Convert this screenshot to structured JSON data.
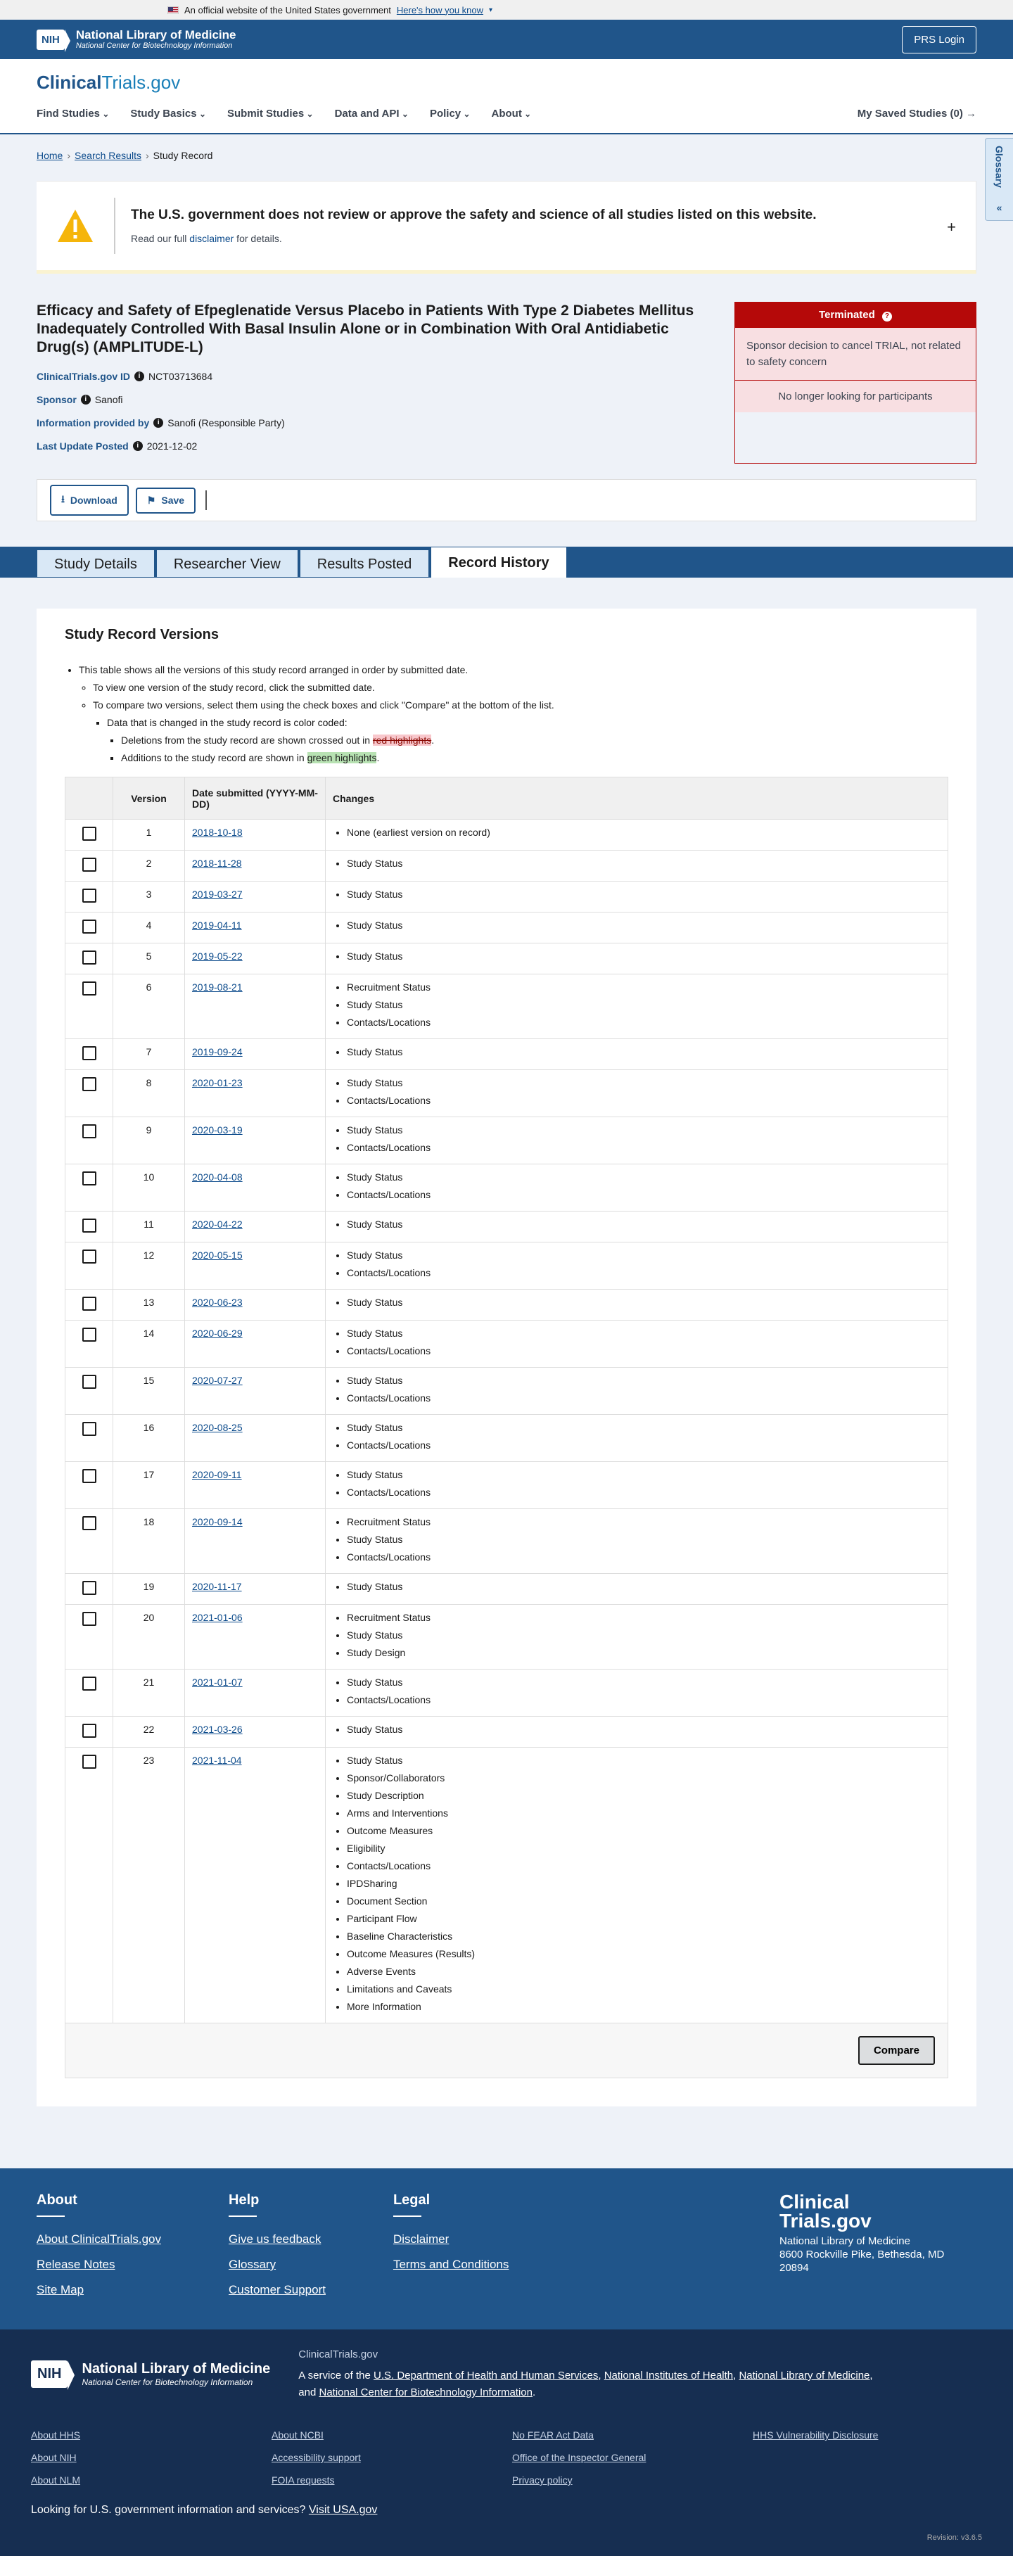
{
  "gov_banner": {
    "text": "An official website of the United States government",
    "link": "Here's how you know"
  },
  "nih_header": {
    "title": "National Library of Medicine",
    "subtitle": "National Center for Biotechnology Information",
    "badge": "NIH",
    "login": "PRS Login"
  },
  "site": {
    "logo_a": "Clinical",
    "logo_b": "Trials.gov"
  },
  "nav": {
    "items": [
      "Find Studies",
      "Study Basics",
      "Submit Studies",
      "Data and API",
      "Policy",
      "About"
    ],
    "saved": "My Saved Studies (0)"
  },
  "breadcrumbs": {
    "home": "Home",
    "search": "Search Results",
    "current": "Study Record"
  },
  "glossary": "Glossary",
  "disclaimer": {
    "title": "The U.S. government does not review or approve the safety and science of all studies listed on this website.",
    "pre": "Read our full ",
    "link": "disclaimer",
    "post": " for details."
  },
  "study": {
    "title": "Efficacy and Safety of Efpeglenatide Versus Placebo in Patients With Type 2 Diabetes Mellitus Inadequately Controlled With Basal Insulin Alone or in Combination With Oral Antidiabetic Drug(s) (AMPLITUDE-L)",
    "id_label": "ClinicalTrials.gov ID",
    "id": "NCT03713684",
    "sponsor_label": "Sponsor",
    "sponsor": "Sanofi",
    "provided_label": "Information provided by",
    "provided": "Sanofi (Responsible Party)",
    "updated_label": "Last Update Posted",
    "updated": "2021-12-02"
  },
  "status": {
    "label": "Terminated",
    "reason": "Sponsor decision to cancel TRIAL, not related to safety concern",
    "recruiting": "No longer looking for participants",
    "color": "#b50909"
  },
  "actions": {
    "download": "Download",
    "save": "Save"
  },
  "tabs": [
    "Study Details",
    "Researcher View",
    "Results Posted",
    "Record History"
  ],
  "history": {
    "heading": "Study Record Versions",
    "intro1": "This table shows all the versions of this study record arranged in order by submitted date.",
    "intro2": "To view one version of the study record, click the submitted date.",
    "intro3": "To compare two versions, select them using the check boxes and click \"Compare\" at the bottom of the list.",
    "intro4": "Data that is changed in the study record is color coded:",
    "intro5_pre": "Deletions from the study record are shown crossed out in ",
    "intro5_hl": "red highlights",
    "intro5_post": ".",
    "intro6_pre": "Additions to the study record are shown in ",
    "intro6_hl": "green highlights",
    "intro6_post": ".",
    "col_version": "Version",
    "col_date": "Date submitted (YYYY-MM-DD)",
    "col_changes": "Changes",
    "compare": "Compare",
    "rows": [
      {
        "v": "1",
        "d": "2018-10-18",
        "c": [
          "None (earliest version on record)"
        ]
      },
      {
        "v": "2",
        "d": "2018-11-28",
        "c": [
          "Study Status"
        ]
      },
      {
        "v": "3",
        "d": "2019-03-27",
        "c": [
          "Study Status"
        ]
      },
      {
        "v": "4",
        "d": "2019-04-11",
        "c": [
          "Study Status"
        ]
      },
      {
        "v": "5",
        "d": "2019-05-22",
        "c": [
          "Study Status"
        ]
      },
      {
        "v": "6",
        "d": "2019-08-21",
        "c": [
          "Recruitment Status",
          "Study Status",
          "Contacts/Locations"
        ]
      },
      {
        "v": "7",
        "d": "2019-09-24",
        "c": [
          "Study Status"
        ]
      },
      {
        "v": "8",
        "d": "2020-01-23",
        "c": [
          "Study Status",
          "Contacts/Locations"
        ]
      },
      {
        "v": "9",
        "d": "2020-03-19",
        "c": [
          "Study Status",
          "Contacts/Locations"
        ]
      },
      {
        "v": "10",
        "d": "2020-04-08",
        "c": [
          "Study Status",
          "Contacts/Locations"
        ]
      },
      {
        "v": "11",
        "d": "2020-04-22",
        "c": [
          "Study Status"
        ]
      },
      {
        "v": "12",
        "d": "2020-05-15",
        "c": [
          "Study Status",
          "Contacts/Locations"
        ]
      },
      {
        "v": "13",
        "d": "2020-06-23",
        "c": [
          "Study Status"
        ]
      },
      {
        "v": "14",
        "d": "2020-06-29",
        "c": [
          "Study Status",
          "Contacts/Locations"
        ]
      },
      {
        "v": "15",
        "d": "2020-07-27",
        "c": [
          "Study Status",
          "Contacts/Locations"
        ]
      },
      {
        "v": "16",
        "d": "2020-08-25",
        "c": [
          "Study Status",
          "Contacts/Locations"
        ]
      },
      {
        "v": "17",
        "d": "2020-09-11",
        "c": [
          "Study Status",
          "Contacts/Locations"
        ]
      },
      {
        "v": "18",
        "d": "2020-09-14",
        "c": [
          "Recruitment Status",
          "Study Status",
          "Contacts/Locations"
        ]
      },
      {
        "v": "19",
        "d": "2020-11-17",
        "c": [
          "Study Status"
        ]
      },
      {
        "v": "20",
        "d": "2021-01-06",
        "c": [
          "Recruitment Status",
          "Study Status",
          "Study Design"
        ]
      },
      {
        "v": "21",
        "d": "2021-01-07",
        "c": [
          "Study Status",
          "Contacts/Locations"
        ]
      },
      {
        "v": "22",
        "d": "2021-03-26",
        "c": [
          "Study Status"
        ]
      },
      {
        "v": "23",
        "d": "2021-11-04",
        "c": [
          "Study Status",
          "Sponsor/Collaborators",
          "Study Description",
          "Arms and Interventions",
          "Outcome Measures",
          "Eligibility",
          "Contacts/Locations",
          "IPDSharing",
          "Document Section",
          "Participant Flow",
          "Baseline Characteristics",
          "Outcome Measures (Results)",
          "Adverse Events",
          "Limitations and Caveats",
          "More Information"
        ]
      }
    ]
  },
  "footer": {
    "cols": [
      {
        "title": "About",
        "links": [
          "About ClinicalTrials.gov",
          "Release Notes",
          "Site Map"
        ]
      },
      {
        "title": "Help",
        "links": [
          "Give us feedback",
          "Glossary",
          "Customer Support"
        ]
      },
      {
        "title": "Legal",
        "links": [
          "Disclaimer",
          "Terms and Conditions"
        ]
      }
    ],
    "logo_a": "Clinical",
    "logo_b": "Trials.gov",
    "addr1": "National Library of Medicine",
    "addr2": "8600 Rockville Pike, Bethesda, MD 20894"
  },
  "footer2": {
    "nih_title": "National Library of Medicine",
    "nih_sub": "National Center for Biotechnology Information",
    "ct": "ClinicalTrials.gov",
    "desc_pre": "A service of the ",
    "hhs": "U.S. Department of Health and Human Services",
    "nih": "National Institutes of Health",
    "nlm": "National Library of Medicine",
    "ncbi": "National Center for Biotechnology Information",
    "links": [
      "About HHS",
      "About NCBI",
      "No FEAR Act Data",
      "HHS Vulnerability Disclosure",
      "About NIH",
      "Accessibility support",
      "Office of the Inspector General",
      "",
      "About NLM",
      "FOIA requests",
      "Privacy policy",
      ""
    ],
    "gov_q": "Looking for U.S. government information and services?",
    "gov_link": "Visit USA.gov",
    "revision": "Revision: v3.6.5"
  }
}
